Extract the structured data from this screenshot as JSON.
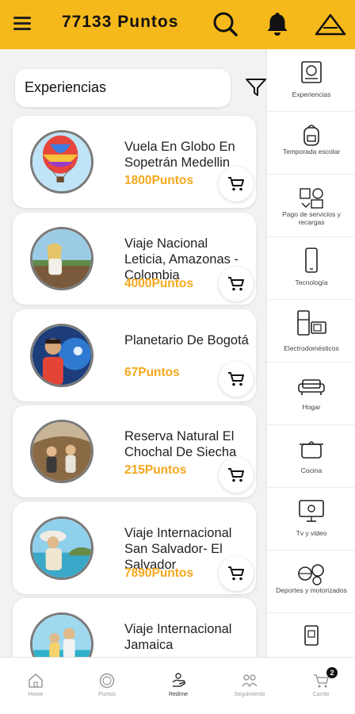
{
  "header": {
    "points_title": "77133 Puntos",
    "icons": [
      "menu-icon",
      "search-icon",
      "bell-icon",
      "triangle-warning-icon"
    ],
    "bg_color": "#f6b91b"
  },
  "category_select": {
    "value": "Experiencias"
  },
  "accent_color": "#f4a81c",
  "products": [
    {
      "title": "Vuela En Globo En Sopetrán Medellin",
      "price": "1800Puntos",
      "image": "hot-air-balloon"
    },
    {
      "title": "Viaje Nacional Leticia, Amazonas - Colombia",
      "price": "4000Puntos",
      "image": "woman-on-dock"
    },
    {
      "title": "Planetario De Bogotá",
      "price": "67Puntos",
      "image": "man-with-planet-dome"
    },
    {
      "title": "Reserva Natural El Chochal De Siecha",
      "price": "215Puntos",
      "image": "hikers-on-hill"
    },
    {
      "title": "Viaje Internacional San Salvador- El Salvador",
      "price": "7890Puntos",
      "image": "woman-on-beach"
    },
    {
      "title": "Viaje Internacional Jamaica",
      "price": "",
      "image": "couple-on-beach"
    }
  ],
  "sidebar": {
    "items": [
      {
        "label": "Experiencias",
        "icon": "passport-icon"
      },
      {
        "label": "Temporada escolar",
        "icon": "backpack-icon"
      },
      {
        "label": "Pago de servicios y recargas",
        "icon": "services-payment-icon"
      },
      {
        "label": "Tecnología",
        "icon": "phone-icon"
      },
      {
        "label": "Electrodomésticos",
        "icon": "fridge-microwave-icon"
      },
      {
        "label": "Hogar",
        "icon": "sofa-icon"
      },
      {
        "label": "Cocina",
        "icon": "pot-icon"
      },
      {
        "label": "Tv y video",
        "icon": "tv-icon"
      },
      {
        "label": "Deportes y motorizados",
        "icon": "sports-balls-icon"
      },
      {
        "label": "",
        "icon": "gift-card-icon"
      }
    ]
  },
  "bottom_nav": {
    "items": [
      {
        "label": "Home",
        "icon": "home-icon",
        "active": false
      },
      {
        "label": "Puntos",
        "icon": "points-coin-icon",
        "active": false
      },
      {
        "label": "Redime",
        "icon": "redeem-hand-icon",
        "active": true
      },
      {
        "label": "Seguimiento",
        "icon": "tracking-people-icon",
        "active": false
      },
      {
        "label": "Carrito",
        "icon": "cart-icon",
        "active": false
      }
    ],
    "cart_badge": "2"
  }
}
